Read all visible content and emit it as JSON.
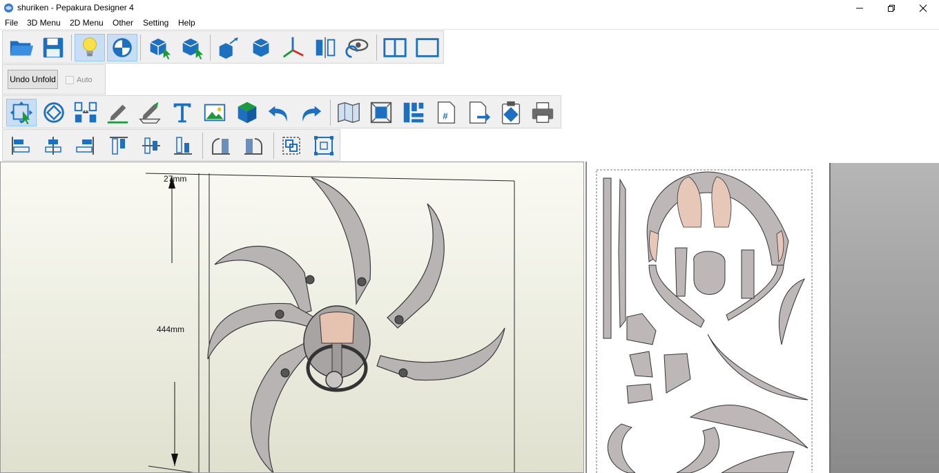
{
  "window": {
    "title": "shuriken - Pepakura Designer 4"
  },
  "menu": {
    "items": [
      "File",
      "3D Menu",
      "2D Menu",
      "Other",
      "Setting",
      "Help"
    ]
  },
  "toolbar_unfold": {
    "undo_label": "Undo Unfold",
    "auto_label": "Auto",
    "auto_checked": false
  },
  "view3d": {
    "dim_top": "27mm",
    "dim_height": "444mm"
  },
  "colors": {
    "accent_blue": "#1a72c4",
    "selected_bg": "#c9def5",
    "toolbar_bg": "#f0f0f0"
  },
  "icons": {
    "main_toolbar": [
      "open-folder-icon",
      "save-icon",
      "lightbulb-icon",
      "texture-toggle-icon",
      "select-face-icon",
      "select-part-icon",
      "move-part-icon",
      "cylinder-icon",
      "axis-icon",
      "mirror-icon",
      "rotate-view-icon",
      "split-view-icon",
      "single-view-icon"
    ],
    "edit_toolbar": [
      "select-move-icon",
      "rotate-icon",
      "flip-join-icon",
      "pen-icon",
      "edge-pen-icon",
      "text-icon",
      "image-icon",
      "cube-color-icon",
      "undo-icon",
      "redo-icon",
      "map-icon",
      "fit-page-icon",
      "arrange-icon",
      "page-number-icon",
      "export-icon",
      "clipboard-icon",
      "print-icon"
    ],
    "align_toolbar": [
      "align-left-icon",
      "align-center-icon",
      "align-right-icon",
      "align-top-icon",
      "align-middle-icon",
      "align-bottom-icon",
      "rotate-left-icon",
      "rotate-right-icon",
      "group-icon",
      "ungroup-icon"
    ]
  }
}
